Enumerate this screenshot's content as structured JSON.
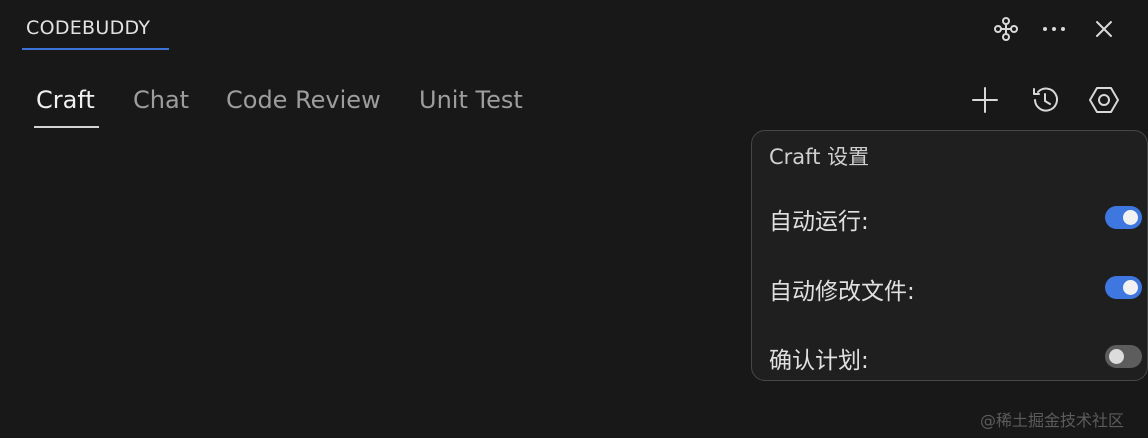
{
  "header": {
    "title": "CODEBUDDY",
    "icons": [
      "plugin-icon",
      "more-icon",
      "close-icon"
    ]
  },
  "tabs": [
    {
      "label": "Craft",
      "active": true
    },
    {
      "label": "Chat",
      "active": false
    },
    {
      "label": "Code Review",
      "active": false
    },
    {
      "label": "Unit Test",
      "active": false
    }
  ],
  "toolbar": {
    "icons": [
      "plus-icon",
      "history-icon",
      "settings-icon"
    ]
  },
  "settings": {
    "title": "Craft 设置",
    "items": [
      {
        "label": "自动运行:",
        "enabled": true
      },
      {
        "label": "自动修改文件:",
        "enabled": true
      },
      {
        "label": "确认计划:",
        "enabled": false
      }
    ]
  },
  "watermark": "@稀土掘金技术社区",
  "colors": {
    "background": "#181818",
    "accent": "#3f77e0",
    "toggle_off": "#5d5d5d"
  }
}
